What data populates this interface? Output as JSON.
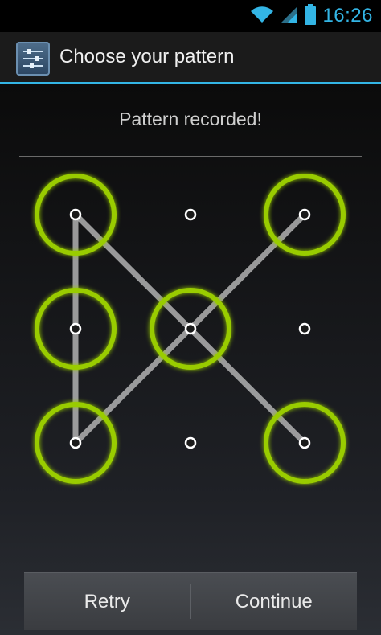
{
  "status_bar": {
    "time": "16:26",
    "icons": [
      "wifi-icon",
      "signal-icon",
      "battery-icon"
    ]
  },
  "action_bar": {
    "title": "Choose your pattern",
    "icon": "settings-sliders-icon"
  },
  "content": {
    "header": "Pattern recorded!"
  },
  "pattern": {
    "grid_size": 3,
    "selected_cells": [
      0,
      2,
      3,
      4,
      6,
      8
    ],
    "path": [
      [
        0,
        8
      ],
      [
        0,
        6
      ],
      [
        6,
        2
      ]
    ],
    "colors": {
      "ring": "#99cc00",
      "line": "#bfbfbf",
      "dot": "#ffffff"
    }
  },
  "buttons": {
    "retry": "Retry",
    "continue": "Continue"
  },
  "colors": {
    "accent": "#33b5e5"
  }
}
